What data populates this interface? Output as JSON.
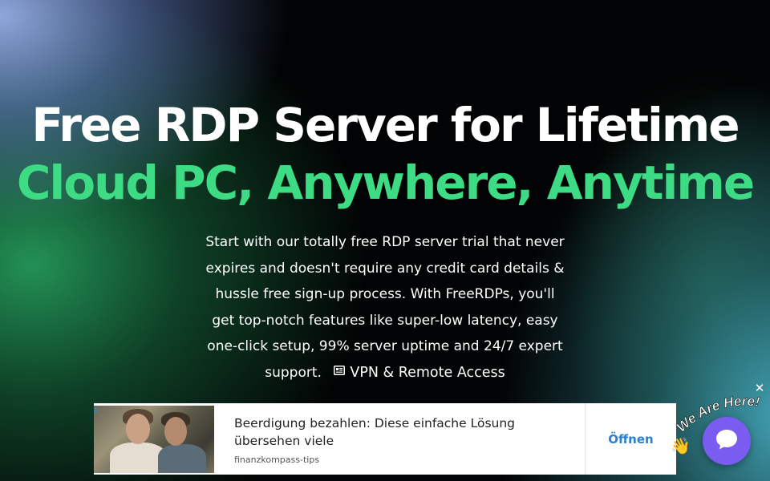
{
  "hero": {
    "title": "Free RDP Server for Lifetime",
    "subtitle": "Cloud PC, Anywhere, Anytime",
    "description": "Start with our totally free RDP server trial that never expires and doesn't require any credit card details & hussle free sign-up process. With FreeRDPs, you'll get top-notch features like super-low latency, easy one-click setup, 99% server uptime and 24/7 expert support.",
    "link_label": "VPN & Remote Access",
    "link_icon": "newspaper-icon"
  },
  "ad": {
    "headline": "Beerdigung bezahlen: Diese einfache Lösung übersehen viele",
    "source": "finanzkompass-tips",
    "cta_label": "Öffnen",
    "close_label": "✕",
    "adchoices_icon": "▷"
  },
  "chat": {
    "callout": "We Are Here!",
    "wave_emoji": "👋",
    "button_icon": "chat-bubble-icon"
  },
  "colors": {
    "accent_green": "#3ddc84",
    "chat_purple": "#7b5cf0",
    "ad_cta_blue": "#2a7fcf"
  }
}
